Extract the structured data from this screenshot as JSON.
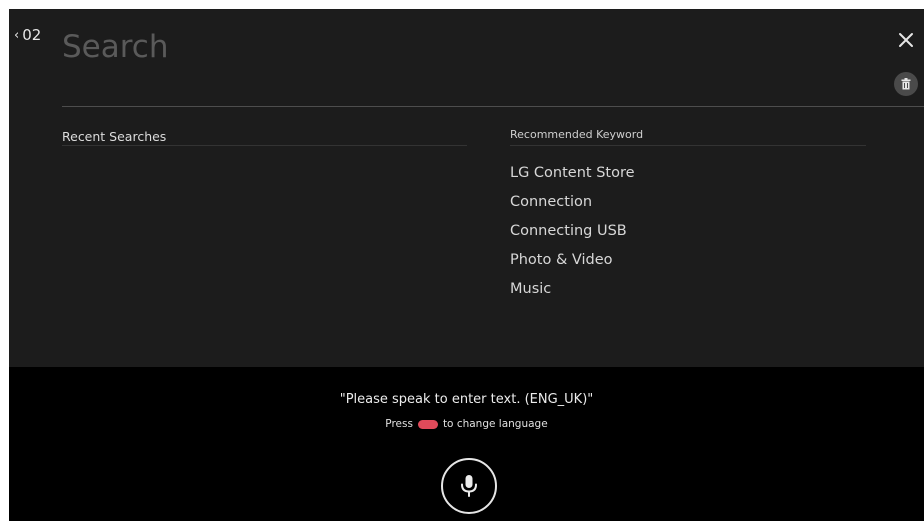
{
  "header": {
    "back_label": "02",
    "search_placeholder": "Search"
  },
  "recent": {
    "title": "Recent Searches",
    "items": []
  },
  "recommended": {
    "title": "Recommended Keyword",
    "items": [
      "LG Content Store",
      "Connection",
      "Connecting USB",
      "Photo & Video",
      "Music"
    ]
  },
  "voice": {
    "prompt": "\"Please speak to enter text. (ENG_UK)\"",
    "hint_prefix": "Press",
    "hint_suffix": "to change language",
    "key_color": "#e04a5a"
  },
  "icons": {
    "back": "chevron-left-icon",
    "close": "close-icon",
    "delete": "trash-icon",
    "mic": "microphone-icon"
  }
}
